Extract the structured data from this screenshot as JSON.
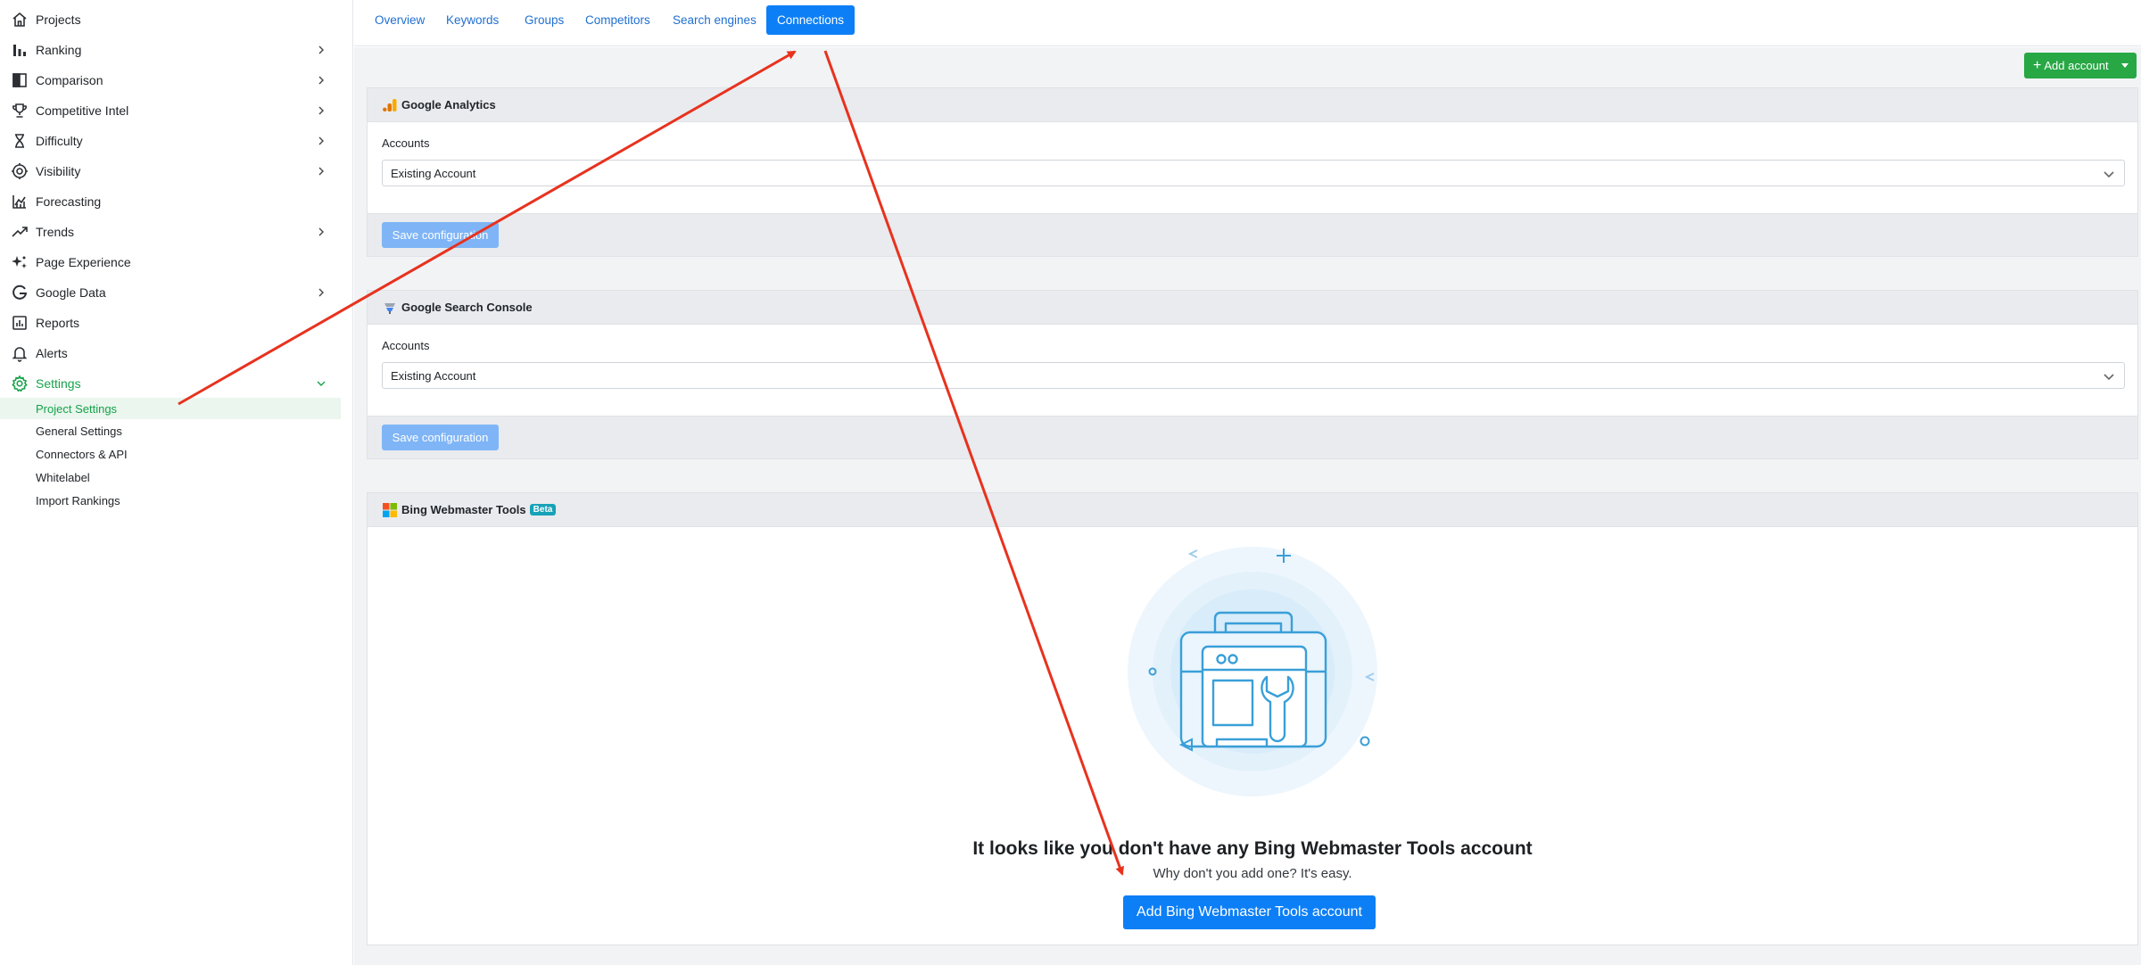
{
  "sidebar": {
    "items": [
      {
        "label": "Projects",
        "icon": "home-icon",
        "chevron": false
      },
      {
        "label": "Ranking",
        "icon": "bar-chart-icon",
        "chevron": true
      },
      {
        "label": "Comparison",
        "icon": "comparison-icon",
        "chevron": true
      },
      {
        "label": "Competitive Intel",
        "icon": "trophy-icon",
        "chevron": true
      },
      {
        "label": "Difficulty",
        "icon": "hourglass-icon",
        "chevron": true
      },
      {
        "label": "Visibility",
        "icon": "eye-gear-icon",
        "chevron": true
      },
      {
        "label": "Forecasting",
        "icon": "line-chart-icon",
        "chevron": false
      },
      {
        "label": "Trends",
        "icon": "trend-up-icon",
        "chevron": true
      },
      {
        "label": "Page Experience",
        "icon": "sparkle-icon",
        "chevron": false
      },
      {
        "label": "Google Data",
        "icon": "google-icon",
        "chevron": true
      },
      {
        "label": "Reports",
        "icon": "report-icon",
        "chevron": false
      },
      {
        "label": "Alerts",
        "icon": "bell-icon",
        "chevron": false
      },
      {
        "label": "Settings",
        "icon": "gear-icon",
        "chevron": true,
        "expanded": true
      }
    ],
    "settings_sub": [
      "Project Settings",
      "General Settings",
      "Connectors & API",
      "Whitelabel",
      "Import Rankings"
    ],
    "active_color": "#16a34a"
  },
  "tabs": [
    {
      "label": "Overview"
    },
    {
      "label": "Keywords"
    },
    {
      "label": "Groups"
    },
    {
      "label": "Competitors"
    },
    {
      "label": "Search engines"
    },
    {
      "label": "Connections",
      "active": true
    }
  ],
  "toolbar": {
    "add_account_label": "Add account"
  },
  "google_analytics": {
    "title": "Google Analytics",
    "accounts_label": "Accounts",
    "selected_account": "Existing Account",
    "save_label": "Save configuration"
  },
  "google_search_console": {
    "title": "Google Search Console",
    "accounts_label": "Accounts",
    "selected_account": "Existing Account",
    "save_label": "Save configuration"
  },
  "bing": {
    "title": "Bing Webmaster Tools",
    "badge": "Beta",
    "empty_title": "It looks like you don't have any Bing Webmaster Tools account",
    "empty_subtitle": "Why don't you add one? It's easy.",
    "add_button_label": "Add Bing Webmaster Tools account"
  },
  "colors": {
    "primary": "#0d7ff6",
    "success": "#28a745",
    "annotation_arrow": "#e8321e"
  }
}
